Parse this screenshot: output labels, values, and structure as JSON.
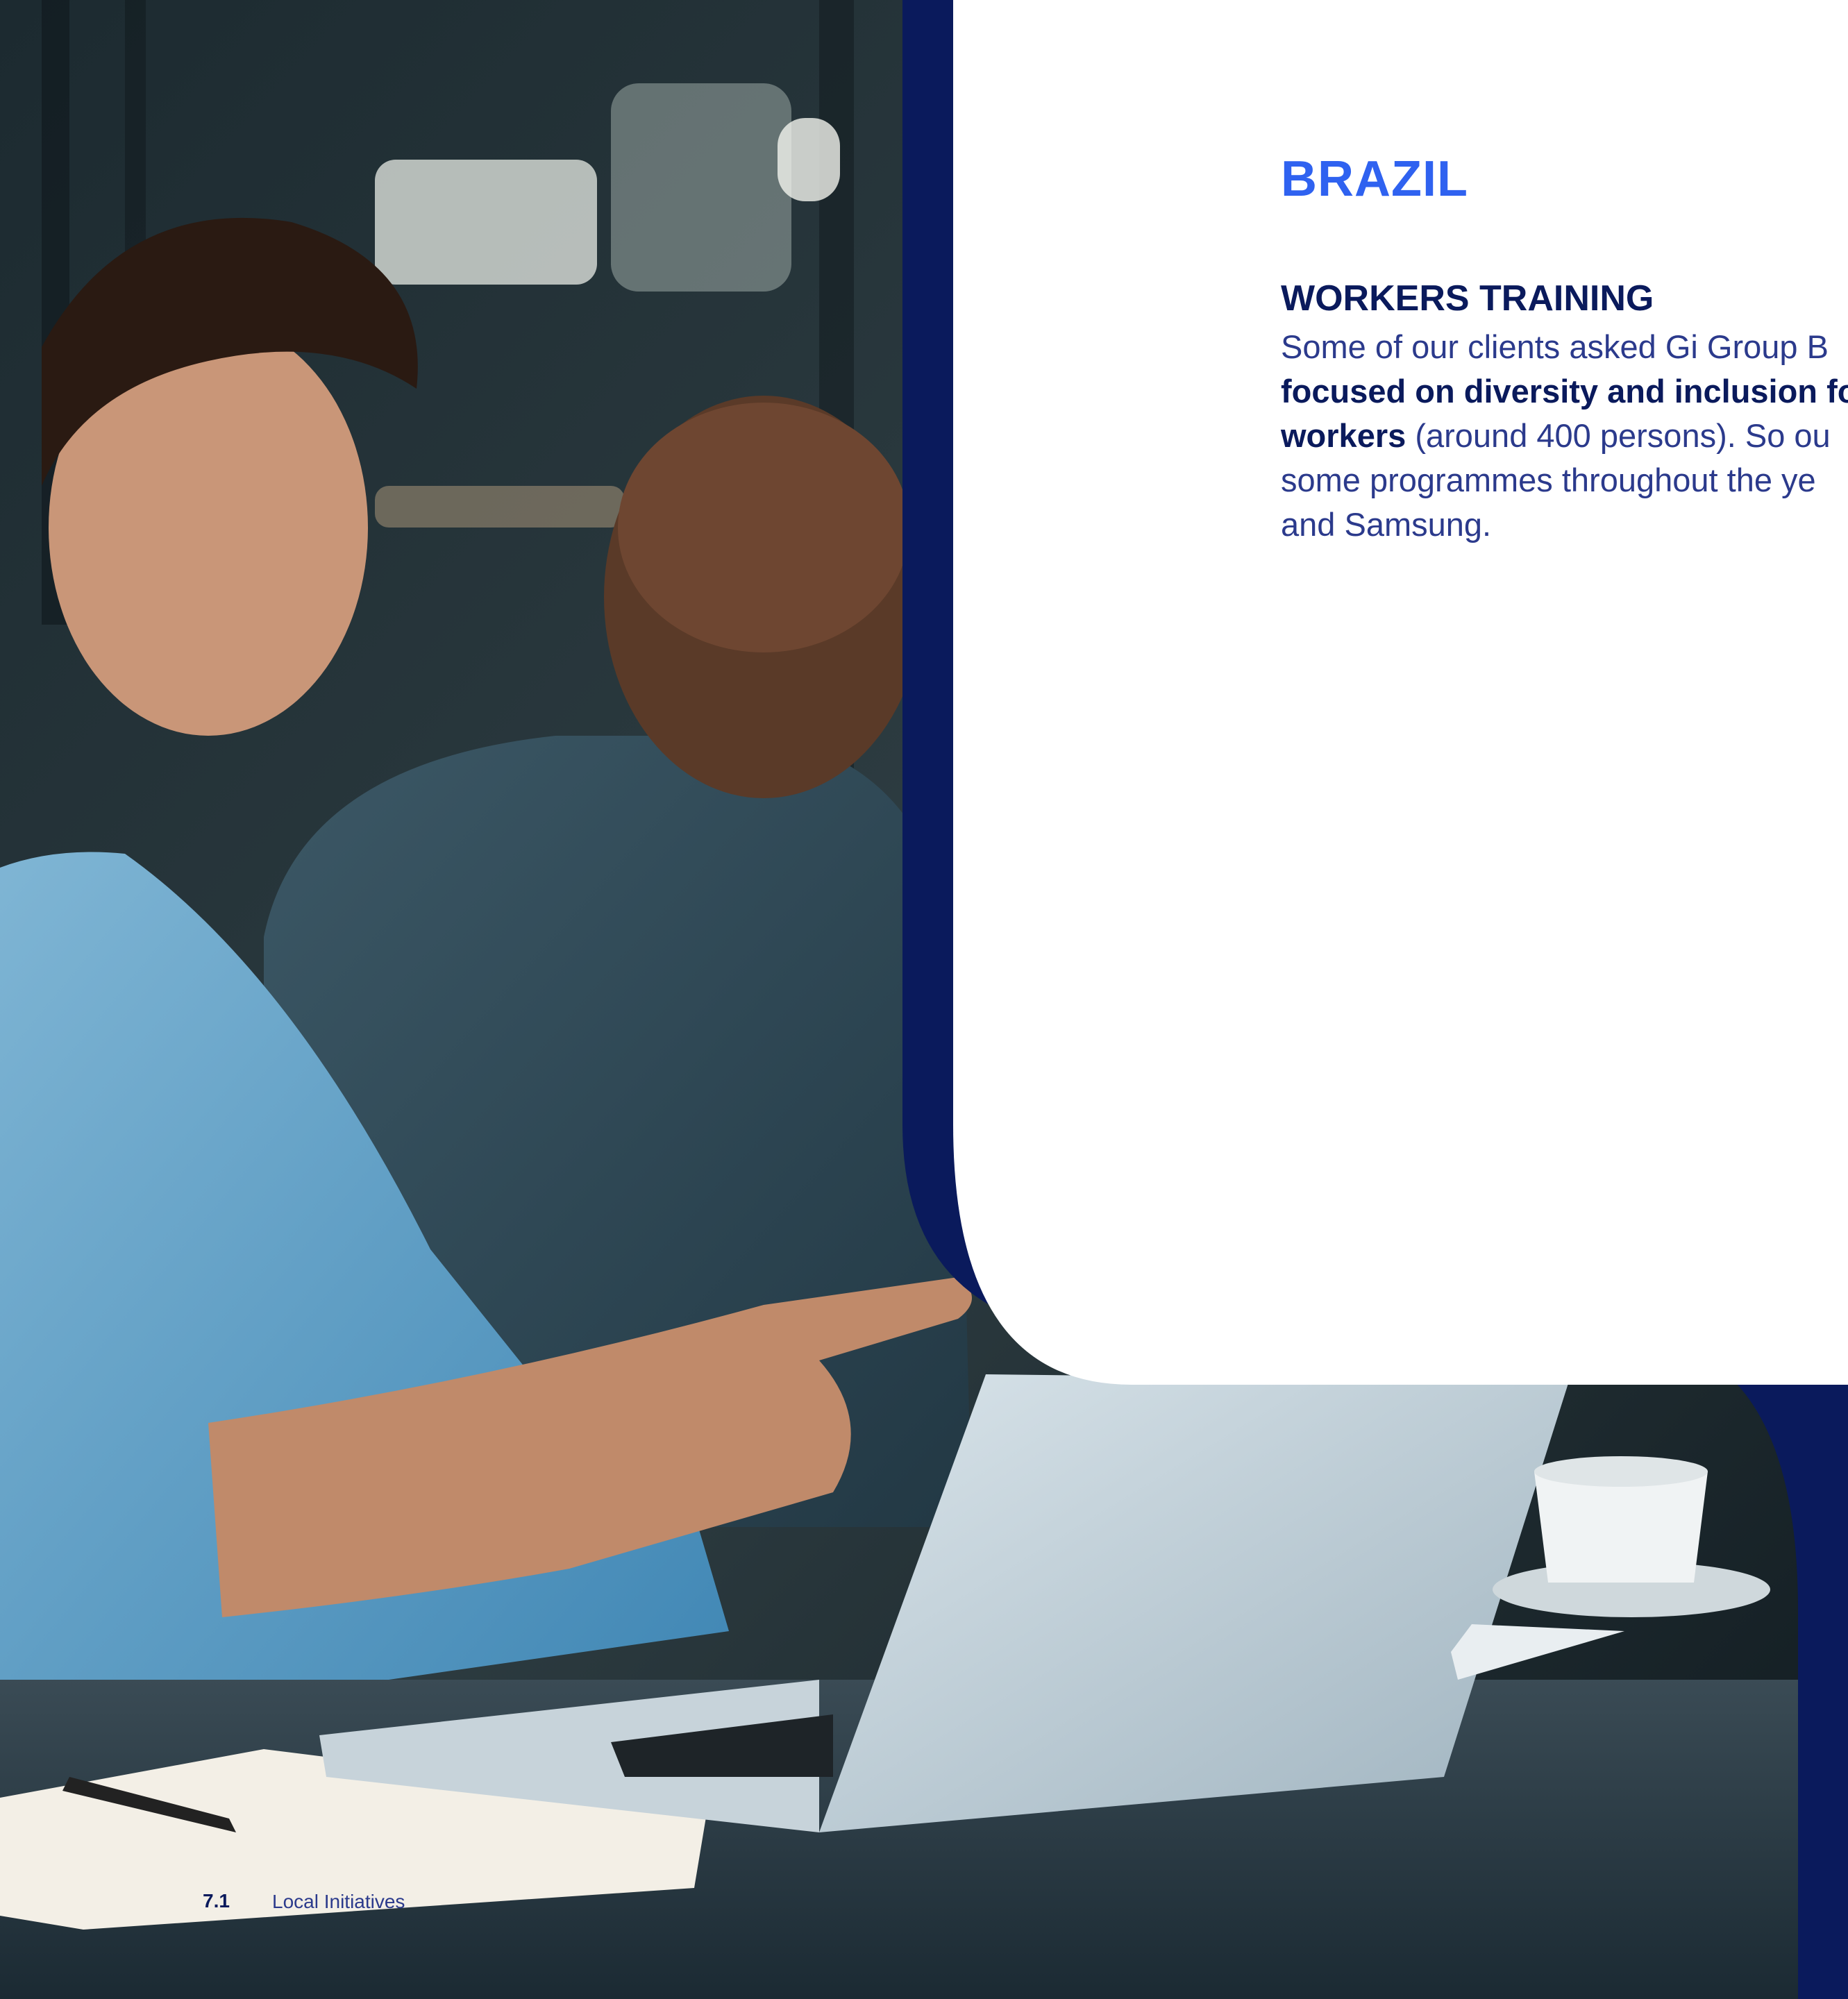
{
  "section": {
    "title": "BRAZIL",
    "subtitle": "WORKERS TRAINING",
    "paragraph": {
      "line1": "Some of our clients asked Gi Group B",
      "line2_bold": "focused on diversity and inclusion fo",
      "line3_bold": "workers",
      "line3_rest": " (around 400 persons). So ou",
      "line4": "some programmes throughout the ye",
      "line5": "and Samsung."
    }
  },
  "footer": {
    "section_number": "7.1",
    "section_label": "Local Initiatives"
  },
  "colors": {
    "navy": "#0a1a5c",
    "accent_blue": "#2f62f0",
    "body_text": "#2b3a8c",
    "background": "#ffffff"
  }
}
